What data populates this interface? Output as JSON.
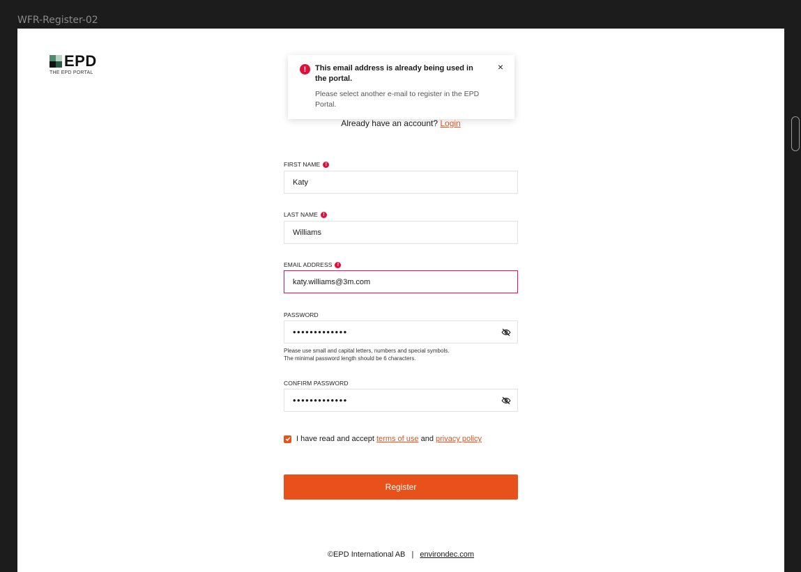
{
  "frame": {
    "label": "WFR-Register-02"
  },
  "logo": {
    "text": "EPD",
    "subtitle": "THE EPD PORTAL"
  },
  "toast": {
    "title": "This email address is already being used in the portal.",
    "body": "Please select another e-mail to register in the EPD Portal.",
    "close": "×"
  },
  "account": {
    "prompt": "Already have an account?",
    "login_label": "Login"
  },
  "form": {
    "first_name": {
      "label": "FIRST NAME",
      "value": "Katy"
    },
    "last_name": {
      "label": "LAST NAME",
      "value": "Williams"
    },
    "email": {
      "label": "EMAIL ADDRESS",
      "value": "katy.williams@3m.com"
    },
    "password": {
      "label": "PASSWORD",
      "value": "•••••••••••••",
      "hint_line1": "Please use small and capital letters, numbers and special symbols.",
      "hint_line2": "The minimal password length should be 6 characters."
    },
    "confirm_password": {
      "label": "CONFIRM PASSWORD",
      "value": "•••••••••••••"
    },
    "terms": {
      "prefix": "I have read and accept",
      "terms_link": "terms of use",
      "conjunction": "and",
      "privacy_link": "privacy policy",
      "checked": true
    },
    "register_label": "Register"
  },
  "footer": {
    "copyright": "©EPD International AB",
    "separator": "|",
    "site": "environdec.com"
  },
  "colors": {
    "accent": "#e8521a",
    "error": "#e0103c",
    "error_border": "#e0106a"
  },
  "icons": {
    "error": "exclamation-circle-icon",
    "eye": "eye-off-icon",
    "check": "check-icon"
  }
}
